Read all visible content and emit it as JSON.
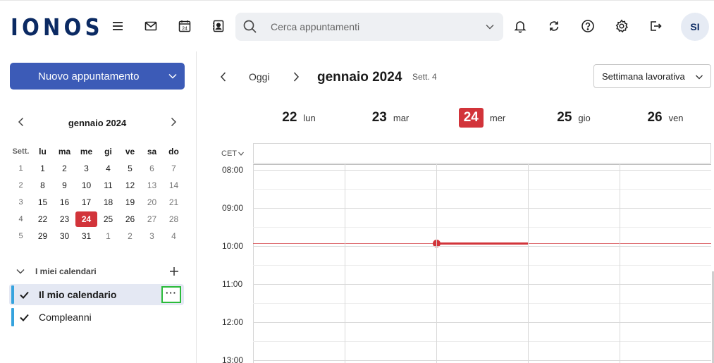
{
  "brand": {
    "logo": "IONOS"
  },
  "header": {
    "search_placeholder": "Cerca appuntamenti",
    "calendar_icon_day": "24",
    "avatar_initials": "SI"
  },
  "sidebar": {
    "new_button_label": "Nuovo appuntamento",
    "mini_calendar": {
      "title": "gennaio 2024",
      "headers": [
        "Sett.",
        "lu",
        "ma",
        "me",
        "gi",
        "ve",
        "sa",
        "do"
      ],
      "weeks": [
        {
          "week": "1",
          "days": [
            "1",
            "2",
            "3",
            "4",
            "5",
            "6",
            "7"
          ]
        },
        {
          "week": "2",
          "days": [
            "8",
            "9",
            "10",
            "11",
            "12",
            "13",
            "14"
          ]
        },
        {
          "week": "3",
          "days": [
            "15",
            "16",
            "17",
            "18",
            "19",
            "20",
            "21"
          ]
        },
        {
          "week": "4",
          "days": [
            "22",
            "23",
            "24",
            "25",
            "26",
            "27",
            "28"
          ]
        },
        {
          "week": "5",
          "days": [
            "29",
            "30",
            "31",
            "1",
            "2",
            "3",
            "4"
          ]
        }
      ],
      "today": "24"
    },
    "my_calendars_label": "I miei calendari",
    "calendars": [
      {
        "name": "Il mio calendario",
        "color": "#36a3de",
        "selected": true
      },
      {
        "name": "Compleanni",
        "color": "#36a3de",
        "selected": false
      }
    ],
    "more_label": "···"
  },
  "toolbar": {
    "today_label": "Oggi",
    "month_title": "gennaio 2024",
    "week_label": "Sett. 4",
    "view_label": "Settimana lavorativa"
  },
  "week": {
    "days": [
      {
        "num": "22",
        "name": "lun",
        "today": false
      },
      {
        "num": "23",
        "name": "mar",
        "today": false
      },
      {
        "num": "24",
        "name": "mer",
        "today": true
      },
      {
        "num": "25",
        "name": "gio",
        "today": false
      },
      {
        "num": "26",
        "name": "ven",
        "today": false
      }
    ],
    "timezone": "CET",
    "hours": [
      "08:00",
      "09:00",
      "10:00",
      "11:00",
      "12:00",
      "13:00"
    ]
  },
  "colors": {
    "brand": "#0b2a63",
    "primary_button": "#3c5bb7",
    "today_red": "#d2343a",
    "calendar_blue": "#36a3de",
    "highlight_green": "#2bbb3a"
  }
}
